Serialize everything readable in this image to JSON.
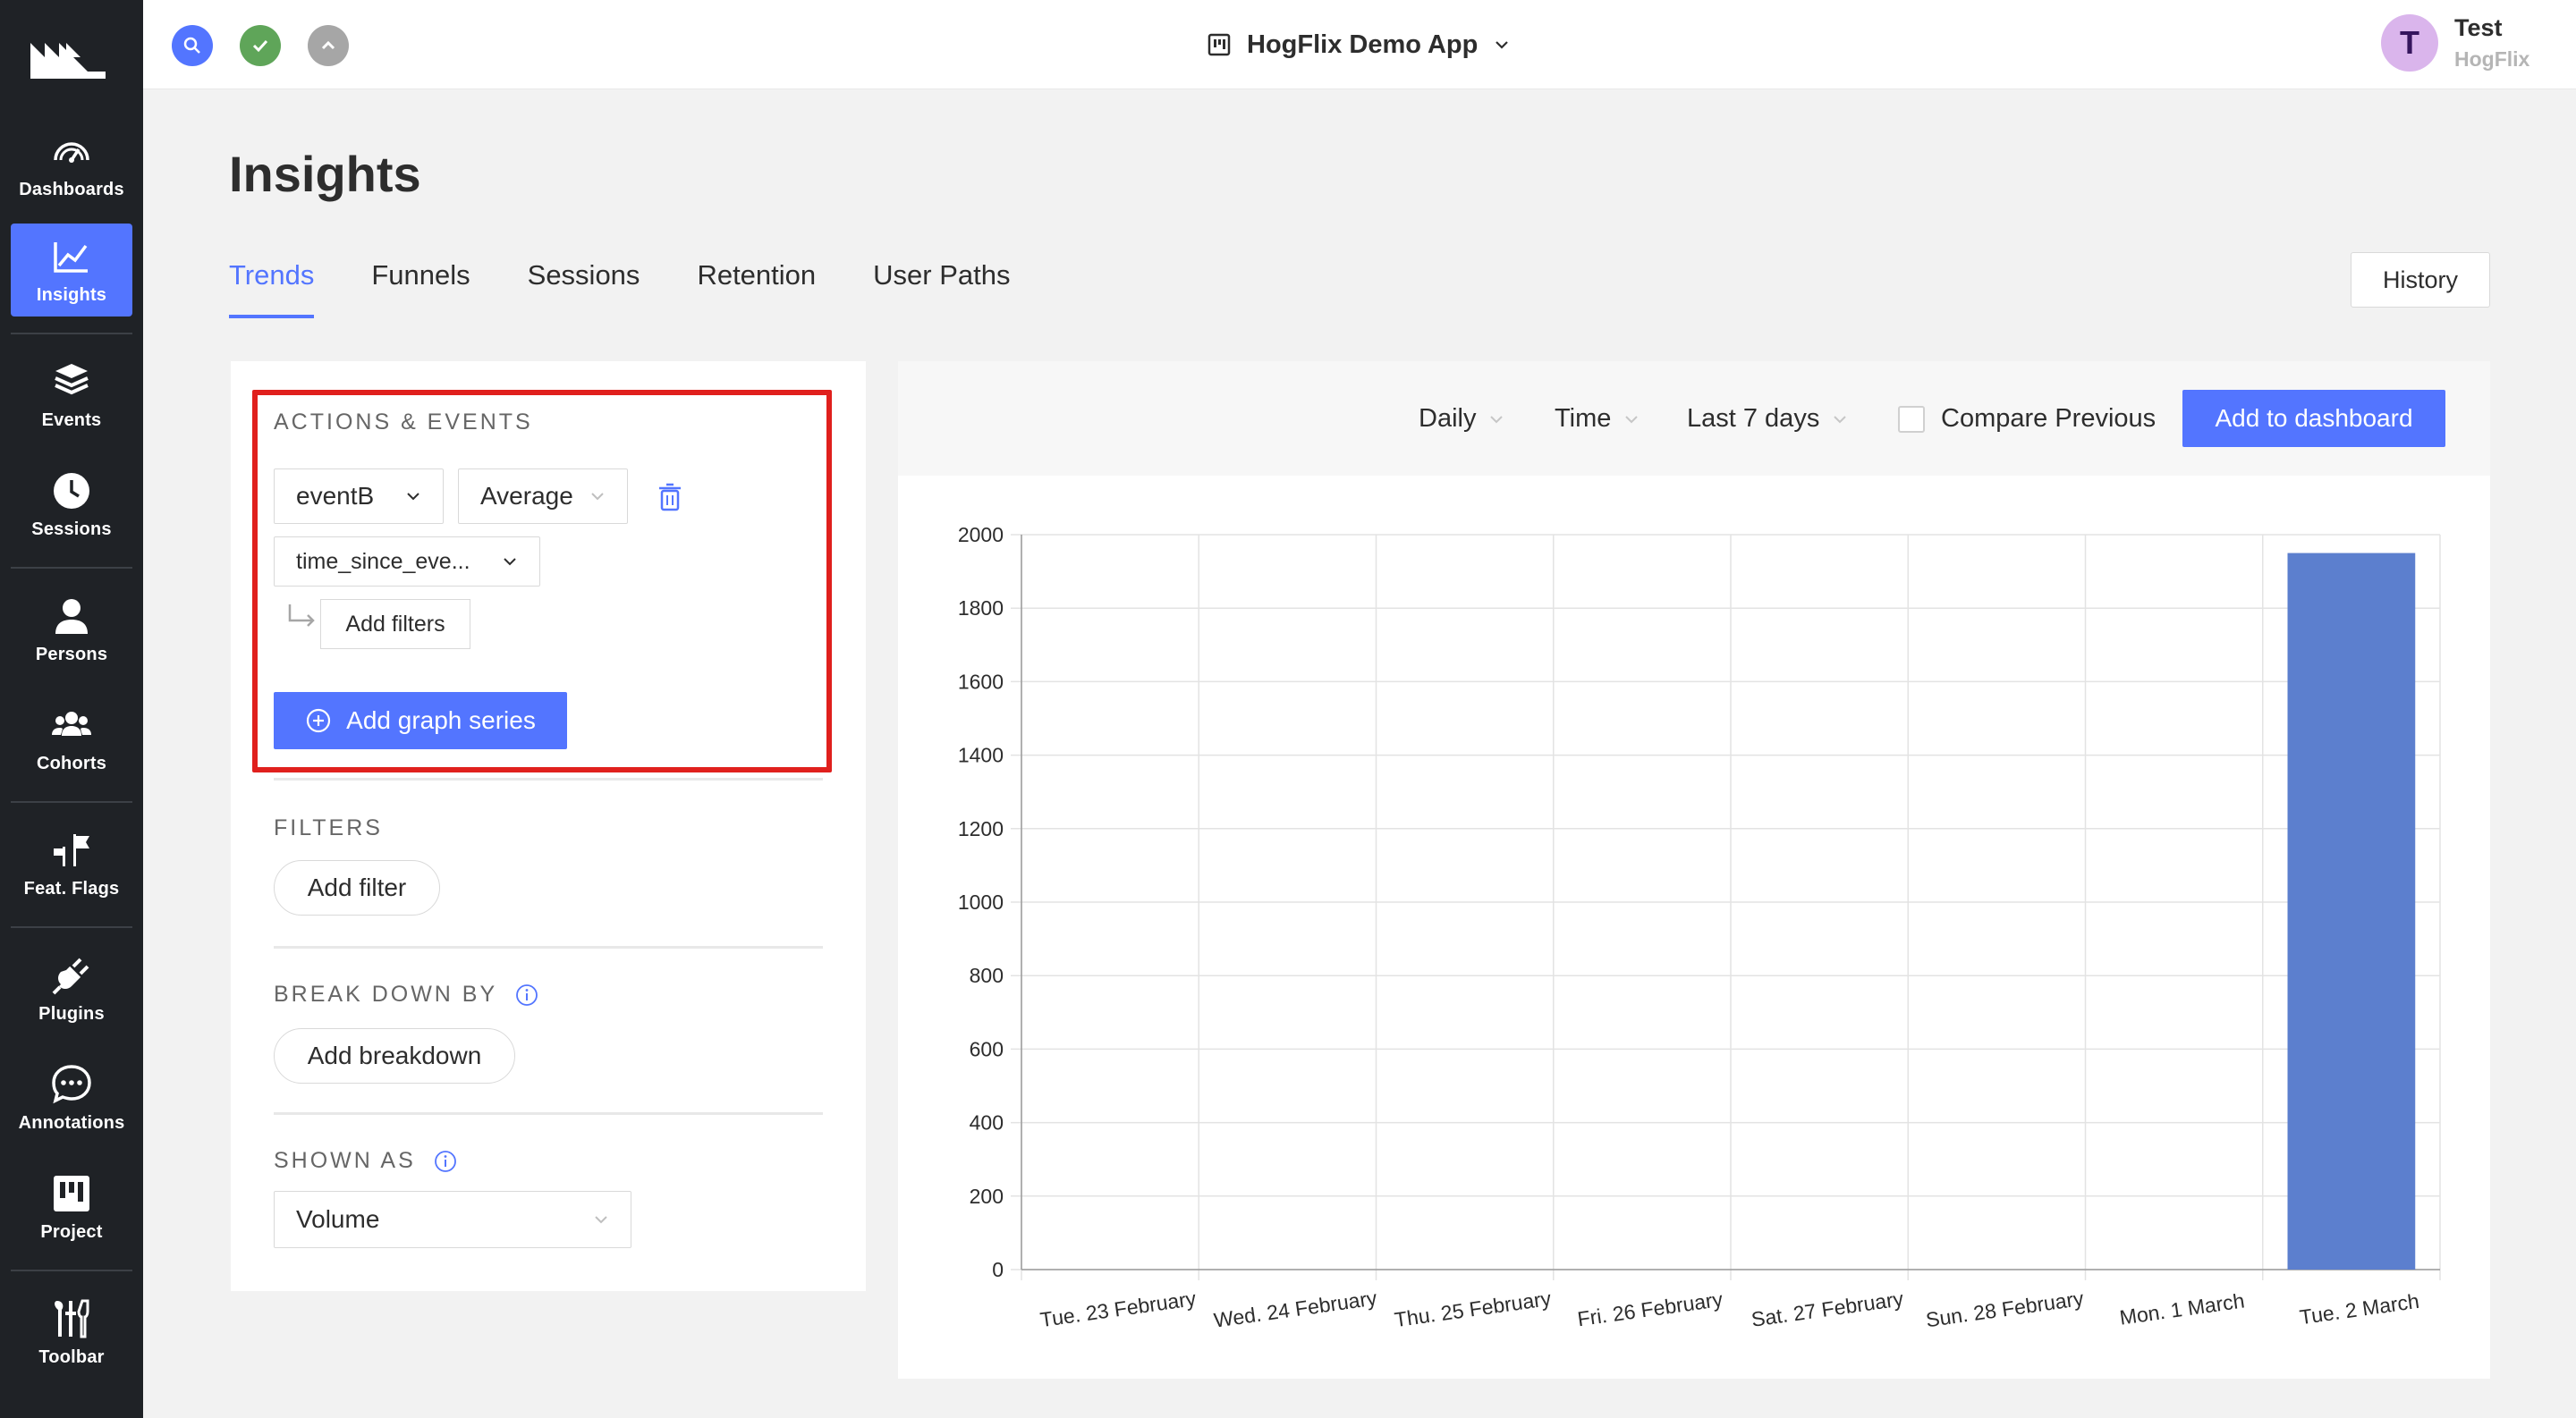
{
  "sidebar": {
    "items": [
      {
        "label": "Dashboards",
        "icon": "dashboard-icon"
      },
      {
        "label": "Insights",
        "icon": "insights-icon",
        "active": true
      },
      {
        "label": "Events",
        "icon": "events-icon"
      },
      {
        "label": "Sessions",
        "icon": "clock-icon"
      },
      {
        "label": "Persons",
        "icon": "person-icon"
      },
      {
        "label": "Cohorts",
        "icon": "cohorts-icon"
      },
      {
        "label": "Feat. Flags",
        "icon": "flags-icon"
      },
      {
        "label": "Plugins",
        "icon": "plug-icon"
      },
      {
        "label": "Annotations",
        "icon": "annotation-icon"
      },
      {
        "label": "Project",
        "icon": "project-icon"
      },
      {
        "label": "Toolbar",
        "icon": "toolbar-icon"
      }
    ]
  },
  "topbar": {
    "project_name": "HogFlix Demo App",
    "user_initial": "T",
    "user_name": "Test",
    "user_org": "HogFlix"
  },
  "page": {
    "title": "Insights",
    "tabs": [
      "Trends",
      "Funnels",
      "Sessions",
      "Retention",
      "User Paths"
    ],
    "active_tab": "Trends",
    "history_label": "History"
  },
  "left_panel": {
    "actions_title": "ACTIONS & EVENTS",
    "event_select": "eventB",
    "math_select": "Average",
    "property_select": "time_since_eve...",
    "add_filters_label": "Add filters",
    "add_series_label": "Add graph series",
    "filters_title": "FILTERS",
    "add_filter_label": "Add filter",
    "breakdown_title": "BREAK DOWN BY",
    "add_breakdown_label": "Add breakdown",
    "shown_as_title": "SHOWN AS",
    "shown_as_value": "Volume"
  },
  "chart_toolbar": {
    "interval": "Daily",
    "time_label": "Time",
    "date_range": "Last 7 days",
    "compare_label": "Compare Previous",
    "add_dashboard_label": "Add to dashboard"
  },
  "colors": {
    "accent": "#5375ff",
    "bar": "#5c7fce",
    "highlight": "#e0201d",
    "sidebar_bg": "#1f2226"
  },
  "chart_data": {
    "type": "bar",
    "categories": [
      "Tue. 23 February",
      "Wed. 24 February",
      "Thu. 25 February",
      "Fri. 26 February",
      "Sat. 27 February",
      "Sun. 28 February",
      "Mon. 1 March",
      "Tue. 2 March"
    ],
    "values": [
      0,
      0,
      0,
      0,
      0,
      0,
      0,
      1950
    ],
    "title": "",
    "xlabel": "",
    "ylabel": "",
    "ylim": [
      0,
      2000
    ],
    "yticks": [
      0,
      200,
      400,
      600,
      800,
      1000,
      1200,
      1400,
      1600,
      1800,
      2000
    ],
    "grid": true
  }
}
